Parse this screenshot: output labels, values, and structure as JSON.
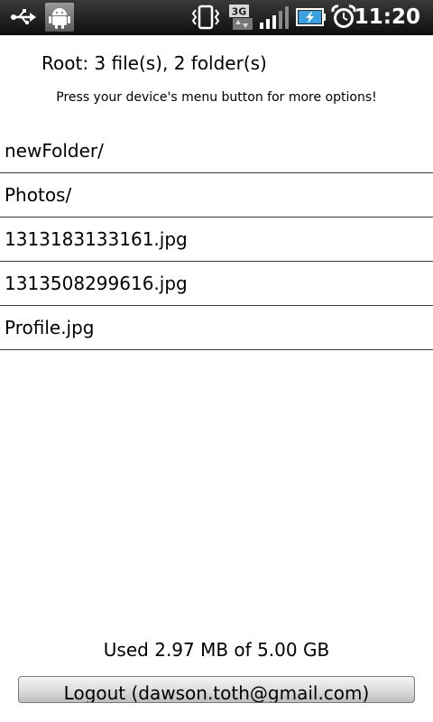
{
  "status_bar": {
    "time": "11:20",
    "network_type": "3G",
    "icons": [
      "usb-icon",
      "android-debug-icon",
      "vibrate-icon",
      "3g-data-icon",
      "signal-icon",
      "battery-charging-icon",
      "alarm-icon"
    ]
  },
  "header": {
    "root_info": "Root: 3 file(s), 2 folder(s)",
    "hint": "Press your device's menu button for more options!"
  },
  "files": [
    {
      "name": "newFolder/"
    },
    {
      "name": "Photos/"
    },
    {
      "name": "1313183133161.jpg"
    },
    {
      "name": "1313508299616.jpg"
    },
    {
      "name": "Profile.jpg"
    }
  ],
  "footer": {
    "usage": "Used 2.97 MB of 5.00 GB",
    "logout_label": "Logout (dawson.toth@gmail.com)"
  },
  "colors": {
    "status_bar_bg": "#1a1a1a",
    "battery_accent": "#3aa0e0",
    "divider": "#3a3a3a"
  }
}
